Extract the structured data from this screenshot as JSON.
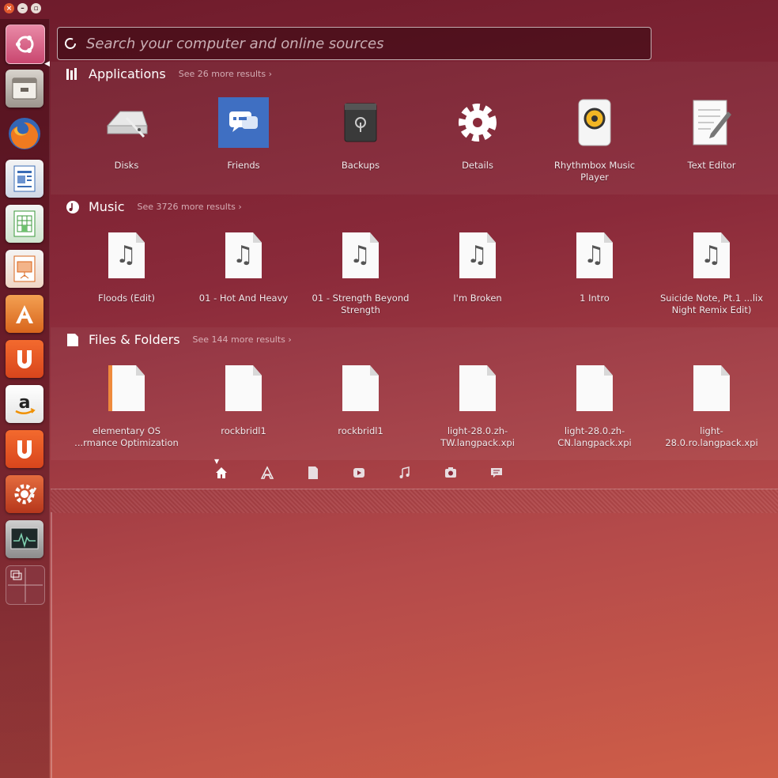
{
  "search": {
    "placeholder": "Search your computer and online sources"
  },
  "launcher": {
    "items": [
      {
        "name": "dash-home-icon"
      },
      {
        "name": "files-icon"
      },
      {
        "name": "firefox-icon"
      },
      {
        "name": "libreoffice-writer-icon"
      },
      {
        "name": "libreoffice-calc-icon"
      },
      {
        "name": "libreoffice-impress-icon"
      },
      {
        "name": "software-center-icon"
      },
      {
        "name": "ubuntu-one-icon"
      },
      {
        "name": "amazon-icon"
      },
      {
        "name": "ubuntu-one-music-icon"
      },
      {
        "name": "system-settings-icon"
      },
      {
        "name": "system-monitor-icon"
      },
      {
        "name": "workspace-switcher-icon"
      }
    ]
  },
  "sections": {
    "applications": {
      "title": "Applications",
      "more": "See 26 more results",
      "items": [
        {
          "label": "Disks",
          "icon": "disks-icon"
        },
        {
          "label": "Friends",
          "icon": "friends-icon"
        },
        {
          "label": "Backups",
          "icon": "backups-icon"
        },
        {
          "label": "Details",
          "icon": "details-gear-icon"
        },
        {
          "label": "Rhythmbox Music Player",
          "icon": "rhythmbox-icon"
        },
        {
          "label": "Text Editor",
          "icon": "text-editor-icon"
        }
      ]
    },
    "music": {
      "title": "Music",
      "more": "See 3726 more results",
      "items": [
        {
          "label": "Floods (Edit)"
        },
        {
          "label": "01 - Hot And Heavy"
        },
        {
          "label": "01 - Strength Beyond Strength"
        },
        {
          "label": "I'm Broken"
        },
        {
          "label": "1 Intro"
        },
        {
          "label": "Suicide Note, Pt.1 ...lix Night Remix Edit)"
        }
      ]
    },
    "files": {
      "title": "Files & Folders",
      "more": "See 144 more results",
      "items": [
        {
          "label": "elementary OS ...rmance Optimization"
        },
        {
          "label": "rockbridl1"
        },
        {
          "label": "rockbridl1"
        },
        {
          "label": "light-28.0.zh-TW.langpack.xpi"
        },
        {
          "label": "light-28.0.zh-CN.langpack.xpi"
        },
        {
          "label": "light-28.0.ro.langpack.xpi"
        }
      ]
    }
  },
  "scopes": [
    "home-scope-icon",
    "applications-scope-icon",
    "files-scope-icon",
    "video-scope-icon",
    "music-scope-icon",
    "photos-scope-icon",
    "social-scope-icon"
  ],
  "colors": {
    "accent": "#c9466f",
    "panel": "#6e1b2b",
    "desktop": "#cf5e48"
  }
}
